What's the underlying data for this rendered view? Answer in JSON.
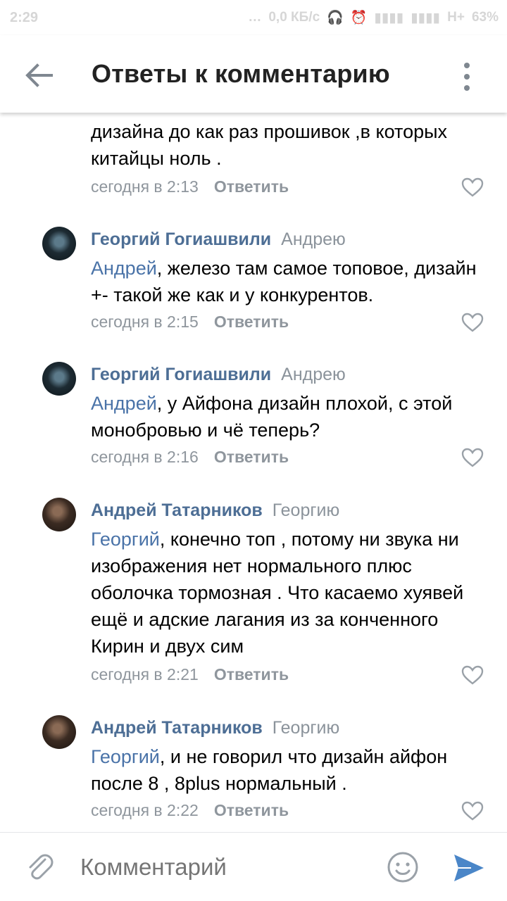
{
  "statusbar": {
    "time": "2:29",
    "dots": "…",
    "speed": "0,0 КБ/с",
    "network": "H+",
    "battery": "63%"
  },
  "header": {
    "title": "Ответы к комментарию"
  },
  "comments": [
    {
      "author": "",
      "to": "",
      "mention": "",
      "text": "дизайна до как раз прошивок ,в которых китайцы ноль .",
      "time": "сегодня в 2:13",
      "reply": "Ответить"
    },
    {
      "author": "Георгий Гогиашвили",
      "to": "Андрею",
      "mention": "Андрей",
      "text": ", железо там самое топовое, дизайн +- такой же как и у конкурентов.",
      "time": "сегодня в 2:15",
      "reply": "Ответить"
    },
    {
      "author": "Георгий Гогиашвили",
      "to": "Андрею",
      "mention": "Андрей",
      "text": ", у Айфона дизайн плохой, с этой монобровью и чё теперь?",
      "time": "сегодня в 2:16",
      "reply": "Ответить"
    },
    {
      "author": "Андрей Татарников",
      "to": "Георгию",
      "mention": "Георгий",
      "text": ", конечно топ , потому ни звука ни изображения нет нормального плюс оболочка тормозная . Что касаемо хуявей ещё и адские лагания из за конченного Кирин  и двух сим",
      "time": "сегодня в 2:21",
      "reply": "Ответить"
    },
    {
      "author": "Андрей Татарников",
      "to": "Георгию",
      "mention": "Георгий",
      "text": ", и не говорил что дизайн айфон после 8 , 8plus нормальный .",
      "time": "сегодня в 2:22",
      "reply": "Ответить"
    }
  ],
  "input": {
    "placeholder": "Комментарий"
  },
  "colors": {
    "author": "#4d6e95",
    "mention": "#4a73a8",
    "meta": "#8f969d",
    "send": "#4a86c8"
  }
}
